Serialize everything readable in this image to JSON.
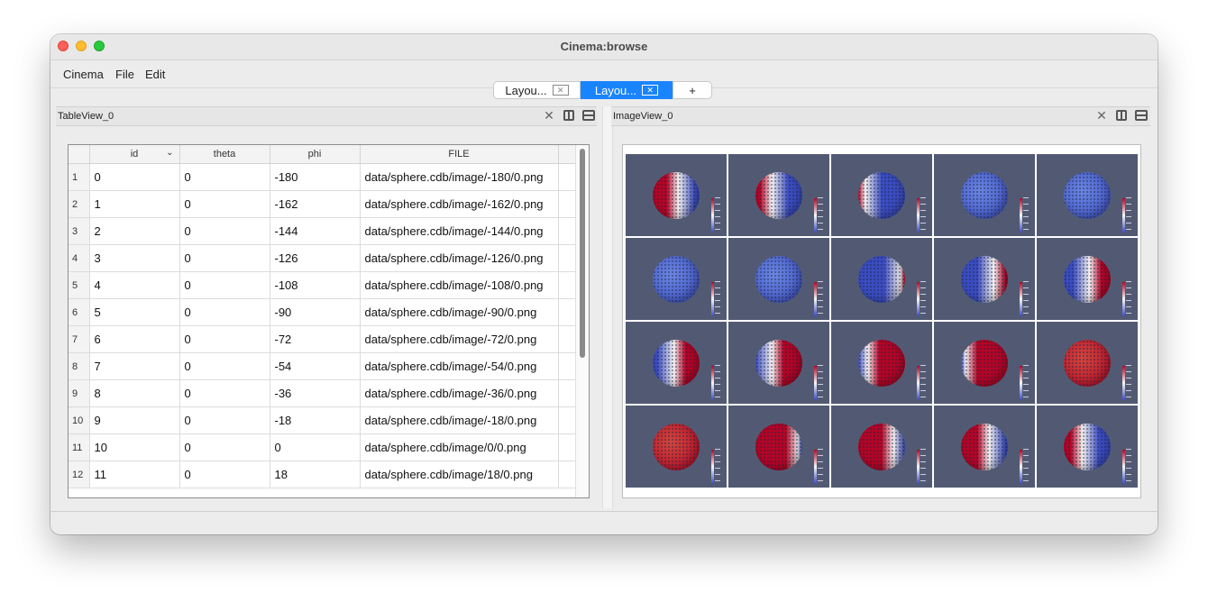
{
  "window": {
    "title": "Cinema:browse"
  },
  "menubar": {
    "items": [
      "Cinema",
      "File",
      "Edit"
    ]
  },
  "tabs": [
    {
      "label": "Layou...",
      "active": false
    },
    {
      "label": "Layou...",
      "active": true
    },
    {
      "label": "+"
    }
  ],
  "table_view": {
    "title": "TableView_0",
    "columns": [
      "id",
      "theta",
      "phi",
      "FILE"
    ],
    "sort_column": "id",
    "rows": [
      {
        "num": "1",
        "id": "0",
        "theta": "0",
        "phi": "-180",
        "file": "data/sphere.cdb/image/-180/0.png"
      },
      {
        "num": "2",
        "id": "1",
        "theta": "0",
        "phi": "-162",
        "file": "data/sphere.cdb/image/-162/0.png"
      },
      {
        "num": "3",
        "id": "2",
        "theta": "0",
        "phi": "-144",
        "file": "data/sphere.cdb/image/-144/0.png"
      },
      {
        "num": "4",
        "id": "3",
        "theta": "0",
        "phi": "-126",
        "file": "data/sphere.cdb/image/-126/0.png"
      },
      {
        "num": "5",
        "id": "4",
        "theta": "0",
        "phi": "-108",
        "file": "data/sphere.cdb/image/-108/0.png"
      },
      {
        "num": "6",
        "id": "5",
        "theta": "0",
        "phi": "-90",
        "file": "data/sphere.cdb/image/-90/0.png"
      },
      {
        "num": "7",
        "id": "6",
        "theta": "0",
        "phi": "-72",
        "file": "data/sphere.cdb/image/-72/0.png"
      },
      {
        "num": "8",
        "id": "7",
        "theta": "0",
        "phi": "-54",
        "file": "data/sphere.cdb/image/-54/0.png"
      },
      {
        "num": "9",
        "id": "8",
        "theta": "0",
        "phi": "-36",
        "file": "data/sphere.cdb/image/-36/0.png"
      },
      {
        "num": "10",
        "id": "9",
        "theta": "0",
        "phi": "-18",
        "file": "data/sphere.cdb/image/-18/0.png"
      },
      {
        "num": "11",
        "id": "10",
        "theta": "0",
        "phi": "0",
        "file": "data/sphere.cdb/image/0/0.png"
      },
      {
        "num": "12",
        "id": "11",
        "theta": "0",
        "phi": "18",
        "file": "data/sphere.cdb/image/18/0.png"
      }
    ]
  },
  "image_view": {
    "title": "ImageView_0",
    "colors": {
      "background": "#525a73",
      "blue": "#3b4cc0",
      "white": "#f2f0ef",
      "red": "#b40426"
    },
    "thumbnails": [
      {
        "red_fraction": 0.55,
        "red_side": "right"
      },
      {
        "red_fraction": 0.35,
        "red_side": "right"
      },
      {
        "red_fraction": 0.15,
        "red_side": "right"
      },
      {
        "red_fraction": 0.0,
        "red_side": "right"
      },
      {
        "red_fraction": 0.0,
        "red_side": "right"
      },
      {
        "red_fraction": 0.0,
        "red_side": "left"
      },
      {
        "red_fraction": 0.0,
        "red_side": "left"
      },
      {
        "red_fraction": 0.1,
        "red_side": "left"
      },
      {
        "red_fraction": 0.3,
        "red_side": "left"
      },
      {
        "red_fraction": 0.45,
        "red_side": "left"
      },
      {
        "red_fraction": 0.55,
        "red_side": "left"
      },
      {
        "red_fraction": 0.65,
        "red_side": "left"
      },
      {
        "red_fraction": 0.8,
        "red_side": "left"
      },
      {
        "red_fraction": 0.9,
        "red_side": "left"
      },
      {
        "red_fraction": 1.0,
        "red_side": "left"
      },
      {
        "red_fraction": 1.0,
        "red_side": "right"
      },
      {
        "red_fraction": 0.9,
        "red_side": "right"
      },
      {
        "red_fraction": 0.75,
        "red_side": "right"
      },
      {
        "red_fraction": 0.6,
        "red_side": "right"
      },
      {
        "red_fraction": 0.4,
        "red_side": "right"
      }
    ]
  }
}
